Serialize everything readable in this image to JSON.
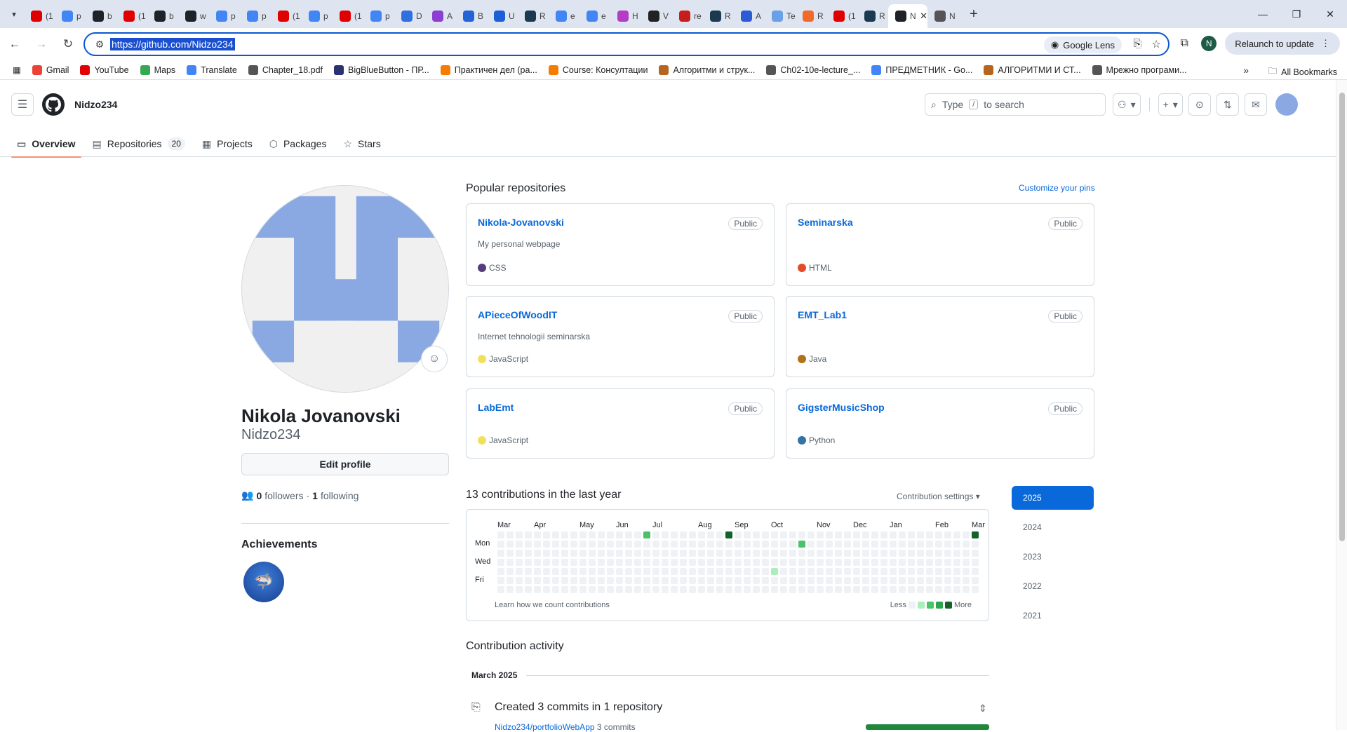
{
  "browser": {
    "tabs": [
      {
        "title": "(1",
        "color": "#e00000"
      },
      {
        "title": "p",
        "color": "#4285f4"
      },
      {
        "title": "b",
        "color": "#1f2328"
      },
      {
        "title": "(1",
        "color": "#e00000"
      },
      {
        "title": "b",
        "color": "#1f2328"
      },
      {
        "title": "w",
        "color": "#1f2328"
      },
      {
        "title": "p",
        "color": "#4285f4"
      },
      {
        "title": "p",
        "color": "#4285f4"
      },
      {
        "title": "(1",
        "color": "#e00000"
      },
      {
        "title": "p",
        "color": "#4285f4"
      },
      {
        "title": "(1",
        "color": "#e00000"
      },
      {
        "title": "p",
        "color": "#4285f4"
      },
      {
        "title": "D",
        "color": "#2f6fdf"
      },
      {
        "title": "A",
        "color": "#8a3fd1"
      },
      {
        "title": "B",
        "color": "#2463d6"
      },
      {
        "title": "U",
        "color": "#1c5fd6"
      },
      {
        "title": "R",
        "color": "#1b3a4f"
      },
      {
        "title": "e",
        "color": "#4285f4"
      },
      {
        "title": "e",
        "color": "#4285f4"
      },
      {
        "title": "H",
        "color": "#b43dc7"
      },
      {
        "title": "V",
        "color": "#222222"
      },
      {
        "title": "re",
        "color": "#c81d1d"
      },
      {
        "title": "R",
        "color": "#1b3a4f"
      },
      {
        "title": "A",
        "color": "#2b5bd6"
      },
      {
        "title": "Te",
        "color": "#6aa0e8"
      },
      {
        "title": "R",
        "color": "#f06b2b"
      },
      {
        "title": "(1",
        "color": "#e00000"
      },
      {
        "title": "R",
        "color": "#1b3a4f"
      },
      {
        "title": "N",
        "color": "#555555"
      }
    ],
    "active_tab": {
      "title": "N",
      "close": "✕"
    },
    "new_tab": "+",
    "url": "https://github.com/Nidzo234",
    "google_lens": "Google Lens",
    "profile_initial": "N",
    "relaunch": "Relaunch to update",
    "bookmarks": [
      {
        "label": "Gmail",
        "color": "#ea4335"
      },
      {
        "label": "YouTube",
        "color": "#e00000"
      },
      {
        "label": "Maps",
        "color": "#34a853"
      },
      {
        "label": "Translate",
        "color": "#4285f4"
      },
      {
        "label": "Chapter_18.pdf",
        "color": "#555555"
      },
      {
        "label": "BigBlueButton - ПР...",
        "color": "#283274"
      },
      {
        "label": "Практичен дел (ра...",
        "color": "#f57c00"
      },
      {
        "label": "Course: Консултации",
        "color": "#f57c00"
      },
      {
        "label": "Алгоритми и струк...",
        "color": "#b5651d"
      },
      {
        "label": "Ch02-10e-lecture_...",
        "color": "#555555"
      },
      {
        "label": "ПРЕДМЕТНИК - Go...",
        "color": "#4285f4"
      },
      {
        "label": "АЛГОРИТМИ И СТ...",
        "color": "#b5651d"
      },
      {
        "label": "Мрежно програми...",
        "color": "#555555"
      }
    ],
    "all_bookmarks": "All Bookmarks"
  },
  "github": {
    "username": "Nidzo234",
    "search_placeholder_pre": "Type",
    "search_key": "/",
    "search_placeholder_post": "to search",
    "tabs": [
      {
        "label": "Overview",
        "icon": "book-icon"
      },
      {
        "label": "Repositories",
        "count": "20",
        "icon": "repo-icon"
      },
      {
        "label": "Projects",
        "icon": "table-icon"
      },
      {
        "label": "Packages",
        "icon": "package-icon"
      },
      {
        "label": "Stars",
        "icon": "star-icon"
      }
    ]
  },
  "profile": {
    "full_name": "Nikola Jovanovski",
    "login": "Nidzo234",
    "edit_profile": "Edit profile",
    "followers_count": "0",
    "followers_label": "followers",
    "following_count": "1",
    "following_label": "following",
    "achievements_title": "Achievements"
  },
  "popular": {
    "title": "Popular repositories",
    "customize": "Customize your pins",
    "repos": [
      {
        "name": "Nikola-Jovanovski",
        "visibility": "Public",
        "description": "My personal webpage",
        "language": "CSS",
        "lang_color": "#563d7c"
      },
      {
        "name": "Seminarska",
        "visibility": "Public",
        "description": "",
        "language": "HTML",
        "lang_color": "#e34c26"
      },
      {
        "name": "APieceOfWoodIT",
        "visibility": "Public",
        "description": "Internet tehnologii seminarska",
        "language": "JavaScript",
        "lang_color": "#f1e05a"
      },
      {
        "name": "EMT_Lab1",
        "visibility": "Public",
        "description": "",
        "language": "Java",
        "lang_color": "#b07219"
      },
      {
        "name": "LabEmt",
        "visibility": "Public",
        "description": "",
        "language": "JavaScript",
        "lang_color": "#f1e05a"
      },
      {
        "name": "GigsterMusicShop",
        "visibility": "Public",
        "description": "",
        "language": "Python",
        "lang_color": "#3572A5"
      }
    ]
  },
  "contributions": {
    "title": "13 contributions in the last year",
    "settings": "Contribution settings ▾",
    "months": [
      "Mar",
      "Apr",
      "May",
      "Jun",
      "Jul",
      "Aug",
      "Sep",
      "Oct",
      "Nov",
      "Dec",
      "Jan",
      "Feb",
      "Mar"
    ],
    "days": [
      "Mon",
      "Wed",
      "Fri"
    ],
    "learn": "Learn how we count contributions",
    "less": "Less",
    "more": "More",
    "level_colors": [
      "#eff2f5",
      "#aceebb",
      "#4ac26b",
      "#2da44e",
      "#116329"
    ],
    "active_cells": [
      {
        "week": 16,
        "day": 0,
        "level": 2
      },
      {
        "week": 25,
        "day": 0,
        "level": 4
      },
      {
        "week": 33,
        "day": 1,
        "level": 2
      },
      {
        "week": 30,
        "day": 4,
        "level": 1
      },
      {
        "week": 52,
        "day": 0,
        "level": 4
      }
    ],
    "years": [
      "2025",
      "2024",
      "2023",
      "2022",
      "2021"
    ],
    "active_year": "2025"
  },
  "activity": {
    "title": "Contribution activity",
    "month": "March 2025",
    "summary": "Created 3 commits in 1 repository",
    "repo": "Nidzo234/portfolioWebApp",
    "repo_commits": "3 commits"
  }
}
